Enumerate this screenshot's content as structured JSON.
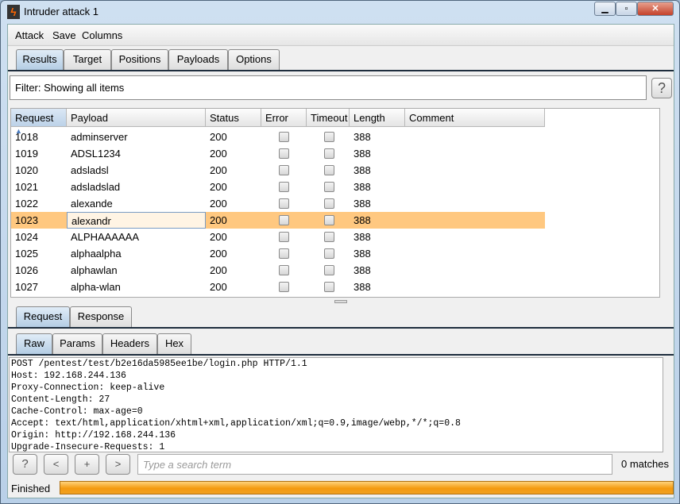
{
  "window": {
    "title": "Intruder attack 1",
    "controls": [
      "minimize",
      "maximize",
      "close"
    ]
  },
  "menu": [
    "Attack",
    "Save",
    "Columns"
  ],
  "tabs": [
    {
      "label": "Results",
      "selected": true
    },
    {
      "label": "Target"
    },
    {
      "label": "Positions"
    },
    {
      "label": "Payloads"
    },
    {
      "label": "Options"
    }
  ],
  "filter": {
    "text": "Filter: Showing all items",
    "help": "?"
  },
  "table": {
    "columns": [
      "Request",
      "Payload",
      "Status",
      "Error",
      "Timeout",
      "Length",
      "Comment"
    ],
    "sort_column": "Request",
    "sort_direction": "ascending",
    "rows": [
      {
        "request": "1018",
        "payload": "adminserver",
        "status": "200",
        "error": false,
        "timeout": false,
        "length": "388",
        "comment": ""
      },
      {
        "request": "1019",
        "payload": "ADSL1234",
        "status": "200",
        "error": false,
        "timeout": false,
        "length": "388",
        "comment": ""
      },
      {
        "request": "1020",
        "payload": "adsladsl",
        "status": "200",
        "error": false,
        "timeout": false,
        "length": "388",
        "comment": ""
      },
      {
        "request": "1021",
        "payload": "adsladslad",
        "status": "200",
        "error": false,
        "timeout": false,
        "length": "388",
        "comment": ""
      },
      {
        "request": "1022",
        "payload": "alexande",
        "status": "200",
        "error": false,
        "timeout": false,
        "length": "388",
        "comment": ""
      },
      {
        "request": "1023",
        "payload": "alexandr",
        "status": "200",
        "error": false,
        "timeout": false,
        "length": "388",
        "comment": "",
        "selected": true
      },
      {
        "request": "1024",
        "payload": "ALPHAAAAAA",
        "status": "200",
        "error": false,
        "timeout": false,
        "length": "388",
        "comment": ""
      },
      {
        "request": "1025",
        "payload": "alphaalpha",
        "status": "200",
        "error": false,
        "timeout": false,
        "length": "388",
        "comment": ""
      },
      {
        "request": "1026",
        "payload": "alphawlan",
        "status": "200",
        "error": false,
        "timeout": false,
        "length": "388",
        "comment": ""
      },
      {
        "request": "1027",
        "payload": "alpha-wlan",
        "status": "200",
        "error": false,
        "timeout": false,
        "length": "388",
        "comment": ""
      }
    ]
  },
  "detail_tabs": [
    {
      "label": "Request",
      "selected": true
    },
    {
      "label": "Response"
    }
  ],
  "view_tabs": [
    {
      "label": "Raw",
      "selected": true
    },
    {
      "label": "Params"
    },
    {
      "label": "Headers"
    },
    {
      "label": "Hex"
    }
  ],
  "raw_lines": [
    "POST /pentest/test/b2e16da5985ee1be/login.php HTTP/1.1",
    "Host: 192.168.244.136",
    "Proxy-Connection: keep-alive",
    "Content-Length: 27",
    "Cache-Control: max-age=0",
    "Accept: text/html,application/xhtml+xml,application/xml;q=0.9,image/webp,*/*;q=0.8",
    "Origin: http://192.168.244.136",
    "Upgrade-Insecure-Requests: 1"
  ],
  "search": {
    "buttons": [
      "?",
      "<",
      "+",
      ">"
    ],
    "placeholder": "Type a search term",
    "value": "",
    "matches": "0 matches"
  },
  "status": {
    "text": "Finished",
    "progress_percent": 100,
    "progress_color": "#f49a10"
  },
  "colors": {
    "selected_row": "#ffc880",
    "tab_selected": "#b4cde4"
  }
}
